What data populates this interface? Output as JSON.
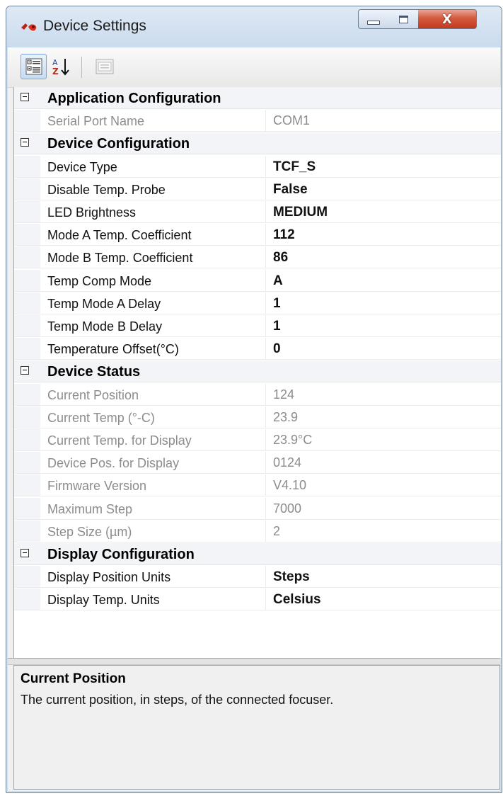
{
  "window": {
    "title": "Device Settings",
    "close_label": "X"
  },
  "toolbar": {
    "buttons": [
      {
        "name": "categorized-view",
        "icon": "categorized-view-icon",
        "active": true
      },
      {
        "name": "alphabetical-sort",
        "icon": "alphabetical-sort-icon",
        "active": false
      },
      {
        "name": "property-pages",
        "icon": "property-pages-icon",
        "active": false,
        "enabled": false
      }
    ]
  },
  "grid": {
    "categories": [
      {
        "label": "Application Configuration",
        "properties": [
          {
            "name": "Serial Port Name",
            "value": "COM1",
            "readonly": true
          }
        ]
      },
      {
        "label": "Device Configuration",
        "properties": [
          {
            "name": "Device Type",
            "value": "TCF_S",
            "readonly": false
          },
          {
            "name": "Disable Temp. Probe",
            "value": "False",
            "readonly": false
          },
          {
            "name": "LED Brightness",
            "value": "MEDIUM",
            "readonly": false
          },
          {
            "name": "Mode A Temp. Coefficient",
            "value": "112",
            "readonly": false
          },
          {
            "name": "Mode B Temp. Coefficient",
            "value": "86",
            "readonly": false
          },
          {
            "name": "Temp Comp Mode",
            "value": "A",
            "readonly": false
          },
          {
            "name": "Temp Mode A Delay",
            "value": "1",
            "readonly": false
          },
          {
            "name": "Temp Mode B Delay",
            "value": "1",
            "readonly": false
          },
          {
            "name": "Temperature Offset(°C)",
            "value": "0",
            "readonly": false
          }
        ]
      },
      {
        "label": "Device Status",
        "properties": [
          {
            "name": "Current Position",
            "value": "124",
            "readonly": true
          },
          {
            "name": "Current Temp (°-C)",
            "value": "23.9",
            "readonly": true
          },
          {
            "name": "Current Temp. for Display",
            "value": "23.9°C",
            "readonly": true
          },
          {
            "name": "Device Pos. for Display",
            "value": "0124",
            "readonly": true
          },
          {
            "name": "Firmware Version",
            "value": "V4.10",
            "readonly": true
          },
          {
            "name": "Maximum Step",
            "value": "7000",
            "readonly": true
          },
          {
            "name": "Step Size (µm)",
            "value": "2",
            "readonly": true
          }
        ]
      },
      {
        "label": "Display Configuration",
        "properties": [
          {
            "name": "Display Position Units",
            "value": "Steps",
            "readonly": false
          },
          {
            "name": "Display Temp. Units",
            "value": "Celsius",
            "readonly": false
          }
        ]
      }
    ]
  },
  "help": {
    "title": "Current Position",
    "description": "The current position, in steps, of the connected focuser."
  },
  "colors": {
    "titlebar": "#c9dbee",
    "close_button": "#c13a1f",
    "category_background": "#f2f4f7",
    "readonly_text": "#8c8c8c"
  }
}
